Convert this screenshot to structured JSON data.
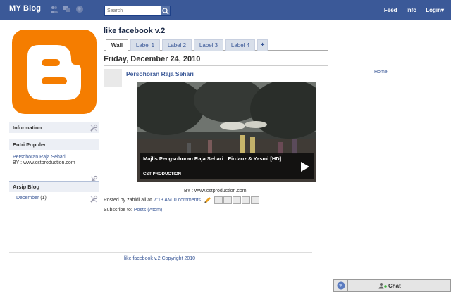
{
  "header": {
    "logo": "MY Blog",
    "search_placeholder": "Search",
    "nav": [
      "Feed",
      "Info",
      "Login▾"
    ]
  },
  "page": {
    "title": "like facebook v.2",
    "tabs": [
      "Wall",
      "Label 1",
      "Label 2",
      "Label 3",
      "Label 4",
      "+"
    ],
    "date": "Friday, December 24, 2010"
  },
  "post": {
    "title": "Persohoran Raja Sehari",
    "video_title": "Majlis Pengsohoran Raja Sehari : Firdauz & Yasmi [HD]",
    "video_channel": "CST PRODUCTION",
    "byline": "BY :  www.cstproduction.com",
    "posted_by": "Posted by zabidi ali at",
    "time": "7:13 AM",
    "comments": "0 comments",
    "share_icons": [
      "email-icon",
      "blogthis-icon",
      "twitter-icon",
      "facebook-icon",
      "buzz-icon"
    ]
  },
  "subscribe": {
    "label": "Subscribe to:",
    "link": "Posts (Atom)"
  },
  "sidebar": {
    "information_title": "Information",
    "entri_title": "Entri Populer",
    "entri_link": "Persohoran Raja Sehari",
    "entri_text": "BY :  www.cstproduction.com",
    "arsip_title": "Arsip Blog",
    "arsip_link": "December",
    "arsip_count": "(1)"
  },
  "right": {
    "home": "Home"
  },
  "footer": {
    "text": "like facebook v.2 Copyright 2010"
  },
  "chat": {
    "label": "Chat"
  },
  "colors": {
    "brand": "#3b5998",
    "blogger_orange": "#f57d00"
  }
}
